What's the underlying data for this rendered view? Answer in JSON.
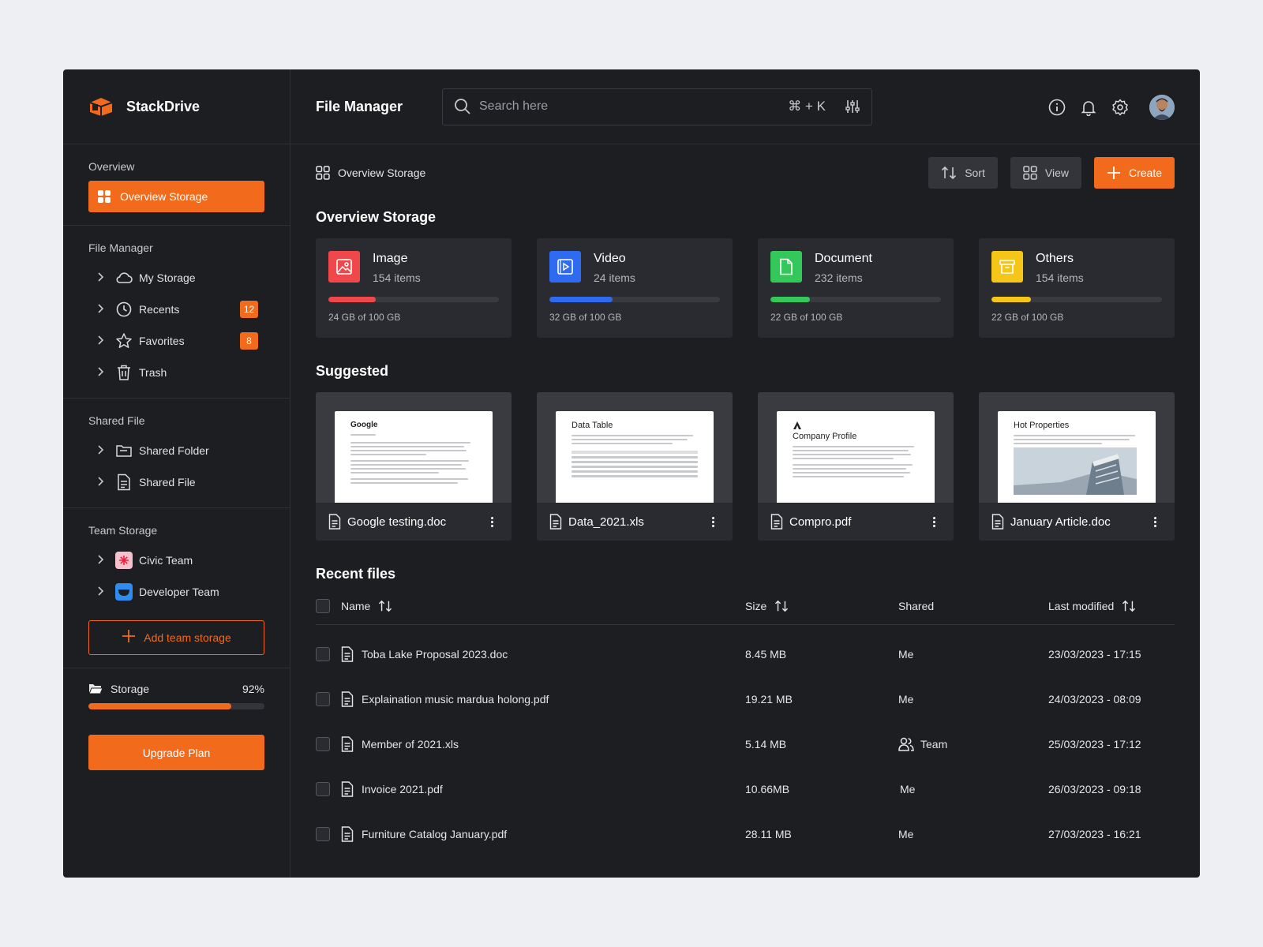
{
  "brand": {
    "name": "StackDrive"
  },
  "colors": {
    "accent": "#F26A1B",
    "image": "#F0474B",
    "video": "#2F6BF0",
    "document": "#34C759",
    "others": "#F5C518"
  },
  "sidebar": {
    "overview_title": "Overview",
    "overview_item": "Overview Storage",
    "file_manager_title": "File Manager",
    "file_manager_items": [
      {
        "label": "My Storage",
        "icon": "cloud-icon"
      },
      {
        "label": "Recents",
        "icon": "clock-icon",
        "badge": "12"
      },
      {
        "label": "Favorites",
        "icon": "star-icon",
        "badge": "8"
      },
      {
        "label": "Trash",
        "icon": "trash-icon"
      }
    ],
    "shared_title": "Shared File",
    "shared_items": [
      {
        "label": "Shared Folder",
        "icon": "folder-icon"
      },
      {
        "label": "Shared File",
        "icon": "file-icon"
      }
    ],
    "team_title": "Team Storage",
    "team_items": [
      {
        "label": "Civic Team",
        "color": "#F7C1CC"
      },
      {
        "label": "Developer Team",
        "color": "#2F8CF0"
      }
    ],
    "add_team_label": "Add team storage",
    "storage_label": "Storage",
    "storage_percent_label": "92%",
    "storage_fraction": 0.81,
    "upgrade_label": "Upgrade Plan"
  },
  "header": {
    "title": "File Manager",
    "search_placeholder": "Search here",
    "shortcut": "⌘ + K"
  },
  "toolbar": {
    "breadcrumb": "Overview Storage",
    "sort_label": "Sort",
    "view_label": "View",
    "create_label": "Create"
  },
  "overview": {
    "title": "Overview Storage",
    "cards": [
      {
        "name": "Image",
        "count": "154 items",
        "usage": "24 GB of 100 GB",
        "fraction": 0.28
      },
      {
        "name": "Video",
        "count": "24 items",
        "usage": "32 GB of 100 GB",
        "fraction": 0.37
      },
      {
        "name": "Document",
        "count": "232 items",
        "usage": "22 GB of 100 GB",
        "fraction": 0.23
      },
      {
        "name": "Others",
        "count": "154 items",
        "usage": "22 GB of 100 GB",
        "fraction": 0.23
      }
    ]
  },
  "suggested": {
    "title": "Suggested",
    "files": [
      {
        "name": "Google testing.doc",
        "preview_title": "Google"
      },
      {
        "name": "Data_2021.xls",
        "preview_title": "Data Table"
      },
      {
        "name": "Compro.pdf",
        "preview_title": "Company Profile"
      },
      {
        "name": "January Article.doc",
        "preview_title": "Hot Properties"
      }
    ]
  },
  "recent": {
    "title": "Recent files",
    "columns": {
      "name": "Name",
      "size": "Size",
      "shared": "Shared",
      "modified": "Last modified"
    },
    "rows": [
      {
        "name": "Toba Lake Proposal 2023.doc",
        "size": "8.45 MB",
        "shared": "Me",
        "modified": "23/03/2023 - 17:15"
      },
      {
        "name": "Explaination music mardua holong.pdf",
        "size": "19.21 MB",
        "shared": "Me",
        "modified": "24/03/2023 - 08:09"
      },
      {
        "name": "Member of 2021.xls",
        "size": "5.14 MB",
        "shared": "Team",
        "modified": "25/03/2023 - 17:12"
      },
      {
        "name": "Invoice 2021.pdf",
        "size": "10.66MB",
        "shared": "Me",
        "modified": "26/03/2023 - 09:18"
      },
      {
        "name": "Furniture Catalog January.pdf",
        "size": "28.11 MB",
        "shared": "Me",
        "modified": "27/03/2023 - 16:21"
      }
    ]
  }
}
